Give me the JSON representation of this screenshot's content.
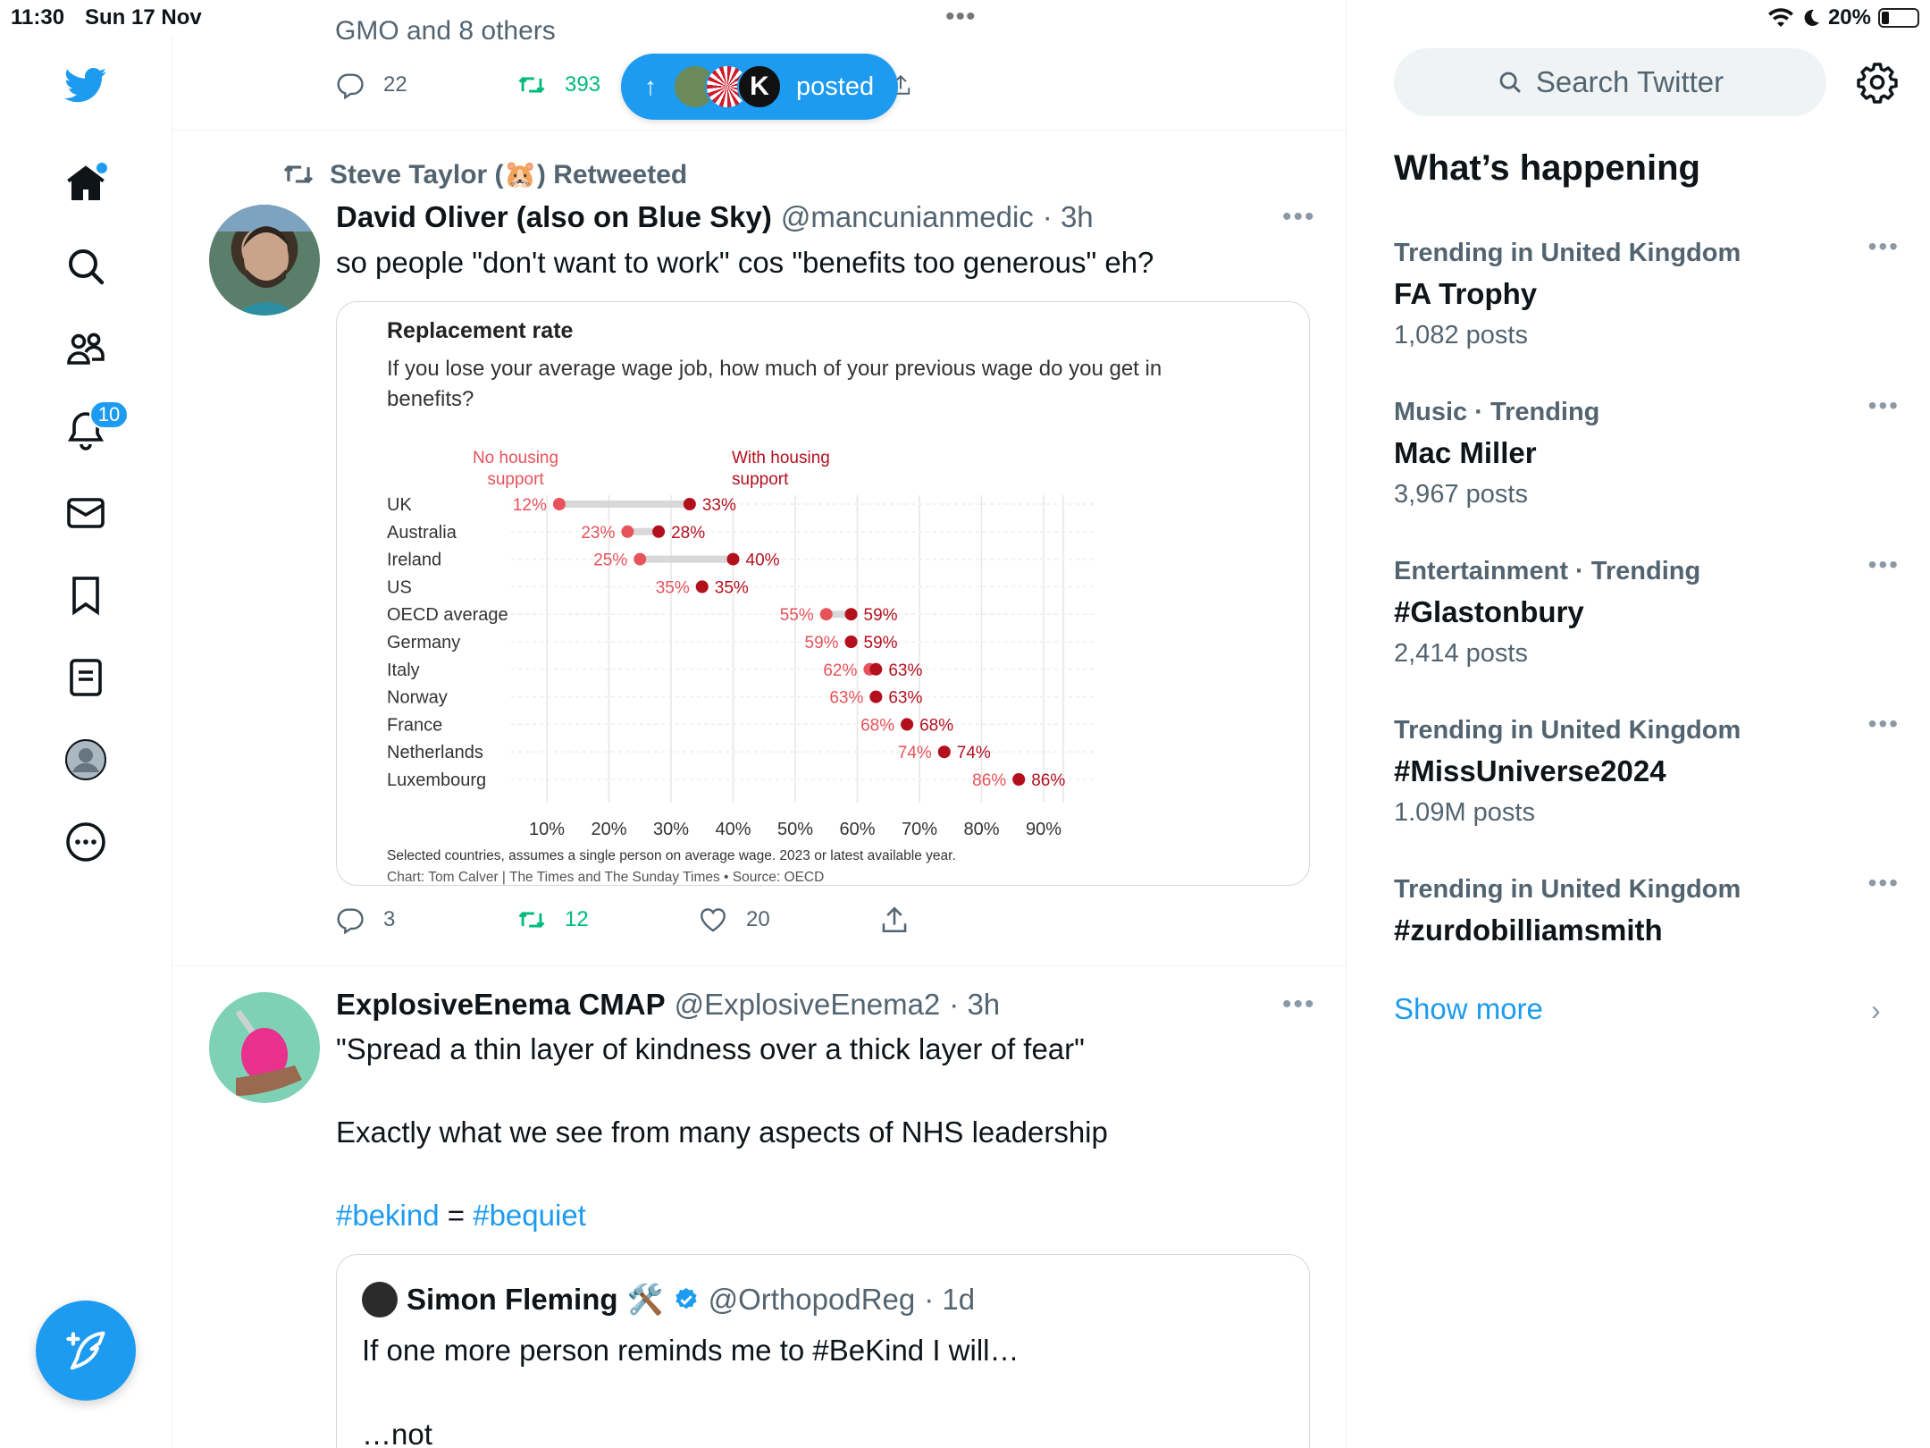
{
  "status_bar": {
    "time": "11:30",
    "date": "Sun 17 Nov",
    "battery": "20%",
    "battery_level": 0.2
  },
  "nav": {
    "notifications_badge": "10"
  },
  "feed": {
    "prev_tweet": {
      "truncated_text": "GMO and 8 others",
      "reply_count": "22",
      "retweet_count": "393"
    },
    "new_posts_pill": {
      "label": "posted",
      "avatar_letter": "K"
    },
    "tweet1": {
      "retweeted_by": "Steve Taylor (🐹) Retweeted",
      "name": "David Oliver (also on Blue Sky)",
      "handle": "@mancunianmedic",
      "time": "· 3h",
      "text": "so people \"don't want to work\" cos \"benefits too generous\" eh?",
      "replies": "3",
      "retweets": "12",
      "likes": "20"
    },
    "tweet2": {
      "name": "ExplosiveEnema CMAP",
      "handle": "@ExplosiveEnema2",
      "time": "· 3h",
      "line1": "\"Spread a thin layer of kindness over a thick layer of fear\"",
      "line2": "Exactly what we see from many aspects of NHS leadership",
      "tag1": "#bekind",
      "eq": " = ",
      "tag2": "#bequiet",
      "quote": {
        "name": "Simon Fleming",
        "tools_emoji": "🛠️",
        "handle": "@OrthopodReg",
        "time": "· 1d",
        "line1": "If one more person reminds me to #BeKind I will…",
        "line2": "…not"
      }
    }
  },
  "sidebar": {
    "search_placeholder": "Search Twitter",
    "heading": "What’s happening",
    "trends": [
      {
        "context": "Trending in United Kingdom",
        "title": "FA Trophy",
        "count": "1,082 posts"
      },
      {
        "context": "Music · Trending",
        "title": "Mac Miller",
        "count": "3,967 posts"
      },
      {
        "context": "Entertainment · Trending",
        "title": "#Glastonbury",
        "count": "2,414 posts"
      },
      {
        "context": "Trending in United Kingdom",
        "title": "#MissUniverse2024",
        "count": "1.09M posts"
      },
      {
        "context": "Trending in United Kingdom",
        "title": "#zurdobilliamsmith",
        "count": ""
      }
    ],
    "show_more": "Show more"
  },
  "chart_data": {
    "type": "scatter",
    "title": "Replacement rate",
    "subtitle": "If you lose your average wage job, how much of your previous wage do you get in benefits?",
    "categories": [
      "UK",
      "Australia",
      "Ireland",
      "US",
      "OECD average",
      "Germany",
      "Italy",
      "Norway",
      "France",
      "Netherlands",
      "Luxembourg"
    ],
    "series": [
      {
        "name": "No housing support",
        "color": "#e8525a",
        "values": [
          12,
          23,
          25,
          35,
          55,
          59,
          62,
          63,
          68,
          74,
          86
        ]
      },
      {
        "name": "With housing support",
        "color": "#b3101d",
        "values": [
          33,
          28,
          40,
          35,
          59,
          59,
          63,
          63,
          68,
          74,
          86
        ]
      }
    ],
    "x_ticks": [
      "10%",
      "20%",
      "30%",
      "40%",
      "50%",
      "60%",
      "70%",
      "80%",
      "90%"
    ],
    "xlim": [
      10,
      90
    ],
    "footnote": "Selected countries, assumes a single person on average wage. 2023 or latest available year.",
    "source": "Chart: Tom Calver | The Times and The Sunday Times • Source: OECD"
  }
}
